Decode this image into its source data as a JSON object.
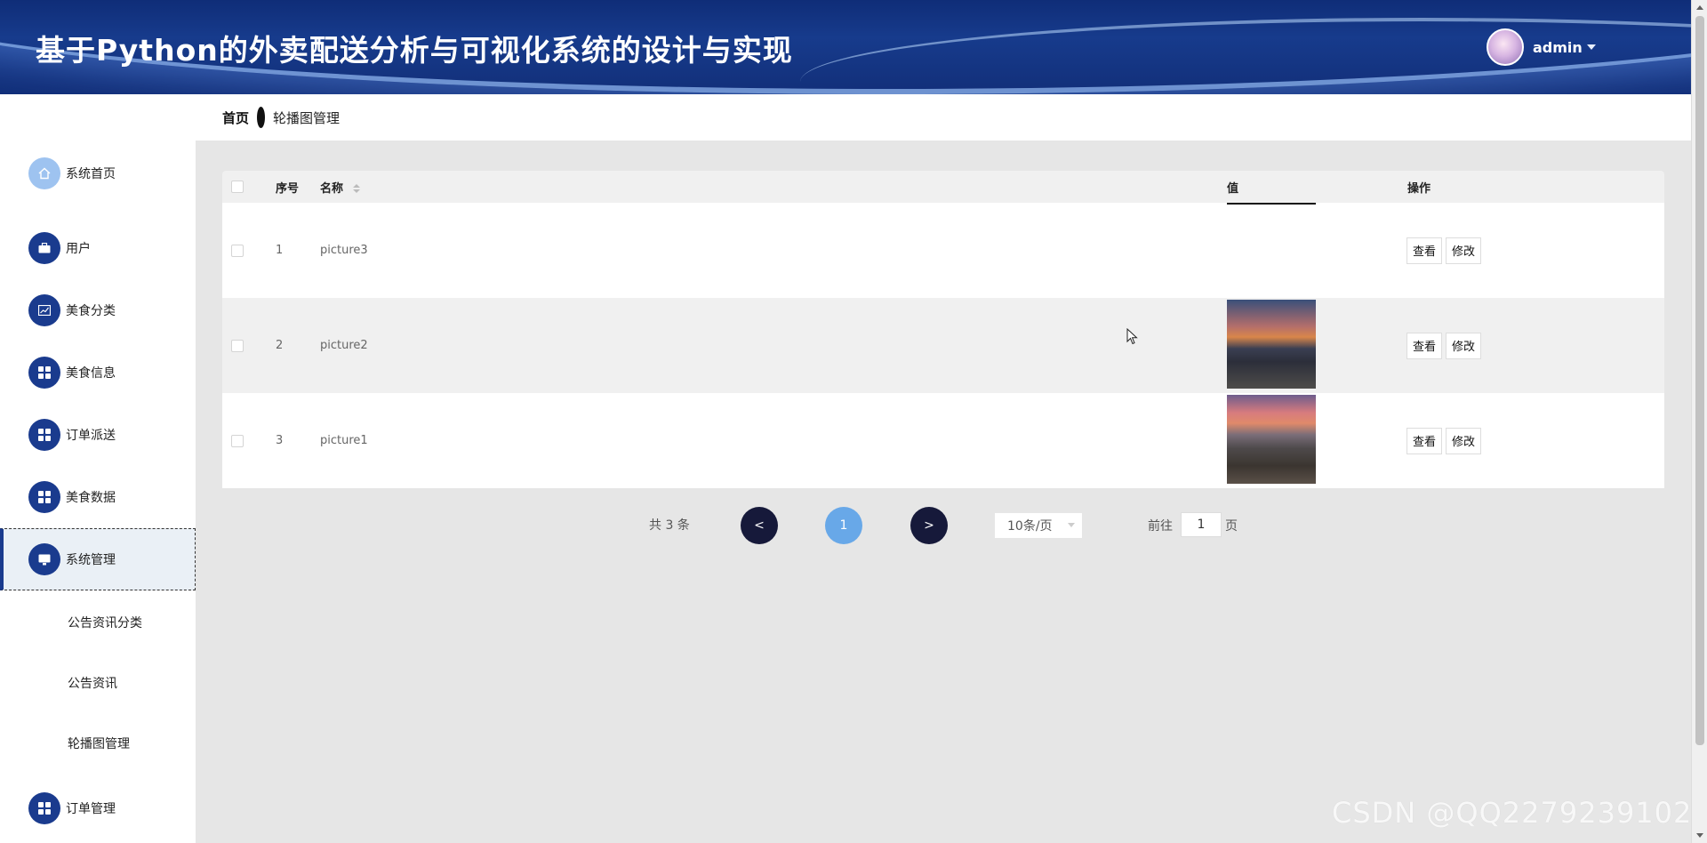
{
  "header": {
    "title": "基于Python的外卖配送分析与可视化系统的设计与实现",
    "user": "admin"
  },
  "breadcrumb": {
    "home": "首页",
    "current": "轮播图管理"
  },
  "sidebar": {
    "items": [
      {
        "label": "系统首页",
        "icon": "home-icon"
      },
      {
        "label": "用户",
        "icon": "briefcase-icon"
      },
      {
        "label": "美食分类",
        "icon": "chart-icon"
      },
      {
        "label": "美食信息",
        "icon": "grid-icon"
      },
      {
        "label": "订单派送",
        "icon": "grid-icon"
      },
      {
        "label": "美食数据",
        "icon": "grid-icon"
      },
      {
        "label": "系统管理",
        "icon": "monitor-icon"
      },
      {
        "label": "订单管理",
        "icon": "grid-icon"
      }
    ],
    "sub_items": [
      "公告资讯分类",
      "公告资讯",
      "轮播图管理"
    ]
  },
  "table": {
    "headers": {
      "index": "序号",
      "name": "名称",
      "value": "值",
      "action": "操作"
    },
    "rows": [
      {
        "index": "1",
        "name": "picture3",
        "image": "broken"
      },
      {
        "index": "2",
        "name": "picture2",
        "image": "dusk-city"
      },
      {
        "index": "3",
        "name": "picture1",
        "image": "sunset-city"
      }
    ],
    "view_label": "查看",
    "edit_label": "修改"
  },
  "pagination": {
    "total": "共 3 条",
    "prev": "<",
    "current_page": "1",
    "next": ">",
    "page_size": "10条/页",
    "goto_label": "前往",
    "goto_value": "1",
    "goto_unit": "页"
  },
  "watermark": "CSDN @QQ2279239102"
}
